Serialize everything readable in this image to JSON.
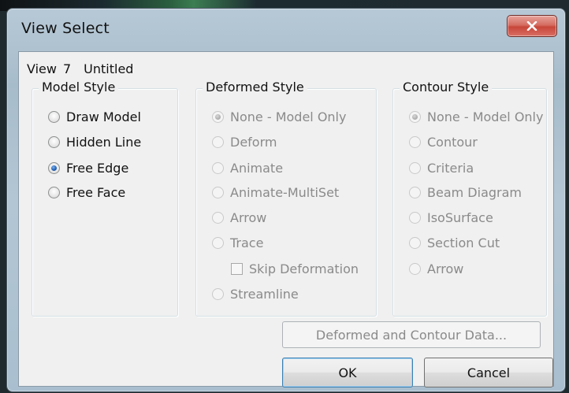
{
  "window": {
    "title": "View Select"
  },
  "view": {
    "label": "View",
    "number": "7",
    "name": "Untitled"
  },
  "model_style": {
    "title": "Model Style",
    "options": [
      {
        "label": "Draw Model",
        "checked": false
      },
      {
        "label": "Hidden Line",
        "checked": false
      },
      {
        "label": "Free Edge",
        "checked": true
      },
      {
        "label": "Free Face",
        "checked": false
      }
    ]
  },
  "deformed_style": {
    "title": "Deformed Style",
    "options": [
      {
        "label": "None - Model Only",
        "checked": true
      },
      {
        "label": "Deform",
        "checked": false
      },
      {
        "label": "Animate",
        "checked": false
      },
      {
        "label": "Animate-MultiSet",
        "checked": false
      },
      {
        "label": "Arrow",
        "checked": false
      },
      {
        "label": "Trace",
        "checked": false
      }
    ],
    "skip_deformation": {
      "label": "Skip Deformation",
      "checked": false
    },
    "streamline": {
      "label": "Streamline",
      "checked": false
    },
    "enabled": false
  },
  "contour_style": {
    "title": "Contour Style",
    "options": [
      {
        "label": "None - Model Only",
        "checked": true
      },
      {
        "label": "Contour",
        "checked": false
      },
      {
        "label": "Criteria",
        "checked": false
      },
      {
        "label": "Beam Diagram",
        "checked": false
      },
      {
        "label": "IsoSurface",
        "checked": false
      },
      {
        "label": "Section Cut",
        "checked": false
      },
      {
        "label": "Arrow",
        "checked": false
      }
    ],
    "enabled": false
  },
  "buttons": {
    "data_label": "Deformed and Contour Data...",
    "ok_label": "OK",
    "cancel_label": "Cancel"
  },
  "icons": {
    "close": "close-icon"
  },
  "colors": {
    "close_button": "#c8463a",
    "radio_checked": "#2361b5"
  }
}
